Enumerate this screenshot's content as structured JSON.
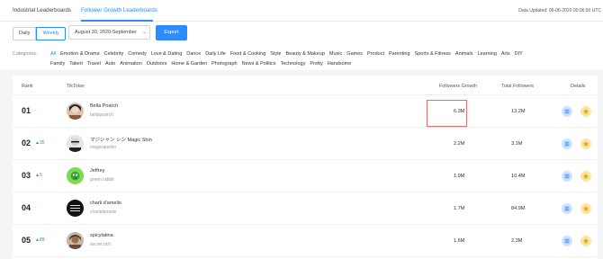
{
  "tabs": [
    {
      "label": "Industrial Leaderboards"
    },
    {
      "label": "Follower Growth Leaderboards"
    }
  ],
  "updated": "Data Updated: 05-06-2020 00:06:50 UTC",
  "period_buttons": [
    "Daily",
    "Weekly"
  ],
  "date_select": "August 30, 2020-September",
  "export_label": "Export",
  "categories_label": "Categories:",
  "categories_row1": [
    "All",
    "Emotion & Drama",
    "Celebrity",
    "Comedy",
    "Love & Dating",
    "Dance",
    "Daily Life",
    "Food & Cooking",
    "Style",
    "Beauty & Makeup",
    "Music",
    "Games",
    "Product",
    "Parenting",
    "Sports & Fitness",
    "Animals",
    "Learning",
    "Arts",
    "DIY"
  ],
  "categories_row2": [
    "Family",
    "Talent",
    "Travel",
    "Auto",
    "Animation",
    "Outdoors",
    "Home & Garden",
    "Photograph",
    "News & Politics",
    "Technology",
    "Pretty",
    "Handsome"
  ],
  "headers": {
    "rank": "Rank",
    "tiktoker": "TikToker",
    "growth": "Followers Growth",
    "total": "Total Followers",
    "details": "Details"
  },
  "rows": [
    {
      "rank": "01",
      "change": "-",
      "name": "Bella Poarch",
      "handle": "bellapoarch",
      "growth": "6.3M",
      "total": "13.2M"
    },
    {
      "rank": "02",
      "change": "▲35",
      "name": "マジシャン シン Magic Shin",
      "handle": "magicianshin",
      "growth": "2.2M",
      "total": "3.1M"
    },
    {
      "rank": "03",
      "change": "▲5",
      "name": "Jeffrey",
      "handle": "green.rabbit",
      "growth": "1.9M",
      "total": "10.4M"
    },
    {
      "rank": "04",
      "change": "-",
      "name": "charli d'amelio",
      "handle": "charlidamelio",
      "growth": "1.7M",
      "total": "84.9M"
    },
    {
      "rank": "05",
      "change": "▲89",
      "name": "spicylatina",
      "handle": "secret.rich",
      "growth": "1.6M",
      "total": "2.3M"
    }
  ],
  "colors": {
    "accent": "#2b8cff",
    "up": "#2aa94a",
    "highlight": "#e46e6e"
  },
  "icons": [
    "list-icon",
    "star-icon"
  ]
}
